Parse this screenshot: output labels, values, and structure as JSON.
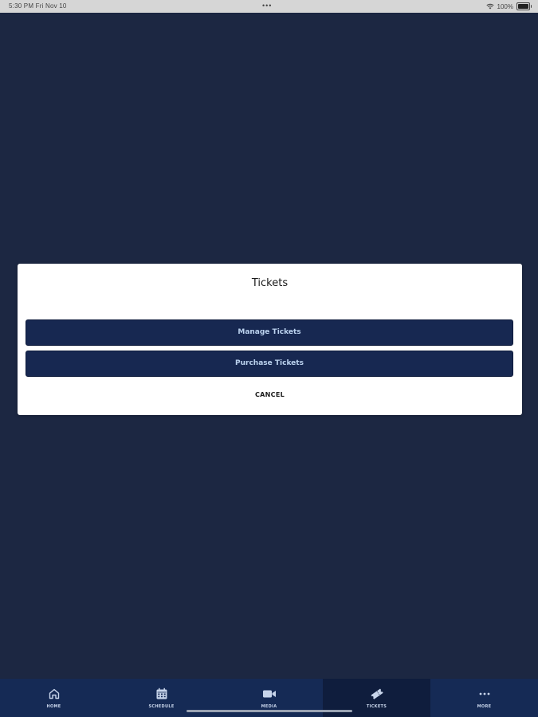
{
  "status_bar": {
    "time_date": "5:30 PM  Fri Nov 10",
    "center_dots": "•••",
    "battery": "100%"
  },
  "modal": {
    "title": "Tickets",
    "buttons": [
      {
        "label": "Manage Tickets"
      },
      {
        "label": "Purchase Tickets"
      }
    ],
    "cancel_label": "CANCEL"
  },
  "tab_bar": {
    "tabs": [
      {
        "label": "HOME",
        "icon": "home-icon"
      },
      {
        "label": "SCHEDULE",
        "icon": "calendar-icon"
      },
      {
        "label": "MEDIA",
        "icon": "video-camera-icon"
      },
      {
        "label": "TICKETS",
        "icon": "ticket-icon",
        "active": true
      },
      {
        "label": "MORE",
        "icon": "more-dots-icon"
      }
    ]
  },
  "colors": {
    "background": "#1c2742",
    "button_bg": "#172851",
    "button_text": "#bcd3ef",
    "tab_bar_bg": "#152a55",
    "tab_active_bg": "#0f1d3d"
  }
}
